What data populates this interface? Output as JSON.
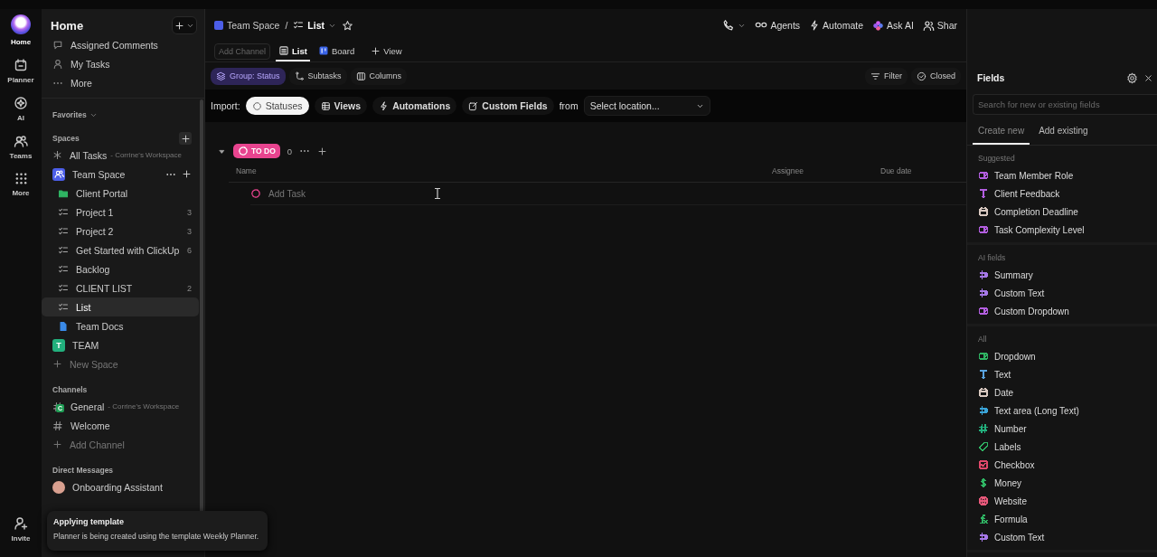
{
  "rail": {
    "items": [
      {
        "kind": "home",
        "label": "Home",
        "selected": true
      },
      {
        "kind": "planner",
        "label": "Planner",
        "selected": false
      },
      {
        "kind": "ai",
        "label": "AI",
        "selected": false
      },
      {
        "kind": "teams",
        "label": "Teams",
        "selected": false
      },
      {
        "kind": "more",
        "label": "More",
        "selected": false
      }
    ],
    "invite": {
      "label": "Invite"
    }
  },
  "sidebar": {
    "title": "Home",
    "nav": [
      {
        "kind": "comments",
        "label": "Assigned Comments"
      },
      {
        "kind": "tasks",
        "label": "My Tasks"
      },
      {
        "kind": "more",
        "label": "More"
      }
    ],
    "favorites": "Favorites",
    "spaces": {
      "label": "Spaces",
      "items": [
        {
          "kind": "all",
          "label": "All Tasks",
          "note": "- Corrine's Workspace"
        },
        {
          "kind": "space",
          "label": "Team Space",
          "color": "#4c5ee8",
          "children": [
            {
              "kind": "folder",
              "label": "Client Portal",
              "selected": false
            },
            {
              "kind": "list",
              "label": "Project 1",
              "count": "3",
              "selected": false
            },
            {
              "kind": "list",
              "label": "Project 2",
              "count": "3",
              "selected": false
            },
            {
              "kind": "list",
              "label": "Get Started with ClickUp",
              "count": "6",
              "selected": false
            },
            {
              "kind": "list",
              "label": "Backlog",
              "selected": false
            },
            {
              "kind": "list",
              "label": "CLIENT LIST",
              "count": "2",
              "selected": false
            },
            {
              "kind": "list",
              "label": "List",
              "selected": true
            },
            {
              "kind": "doc",
              "label": "Team Docs",
              "selected": false
            }
          ]
        },
        {
          "kind": "space",
          "label": "TEAM",
          "letter": "T",
          "color": "#22b07d"
        },
        {
          "kind": "add",
          "label": "New Space"
        }
      ]
    },
    "channels": {
      "label": "Channels",
      "items": [
        {
          "kind": "channel",
          "label": "General",
          "note": "- Corrine's Workspace",
          "badge": "C"
        },
        {
          "kind": "channel",
          "label": "Welcome"
        },
        {
          "kind": "add",
          "label": "Add Channel"
        }
      ]
    },
    "direct_messages": {
      "label": "Direct Messages",
      "items": [
        {
          "label": "Onboarding Assistant"
        }
      ]
    }
  },
  "toast": {
    "title": "Applying template",
    "message": "Planner is being created using the template Weekly Planner."
  },
  "header": {
    "breadcrumb": [
      "Team Space",
      "/",
      "List"
    ],
    "actions": [
      {
        "kind": "agents",
        "label": "Agents"
      },
      {
        "kind": "automate",
        "label": "Automate"
      },
      {
        "kind": "ai",
        "label": "Ask AI"
      },
      {
        "kind": "share",
        "label": "Shar"
      }
    ]
  },
  "views": {
    "add_channel": "Add Channel",
    "tabs": [
      {
        "kind": "list",
        "label": "List",
        "selected": true
      },
      {
        "kind": "board",
        "label": "Board",
        "selected": false
      }
    ],
    "add_view": "View"
  },
  "toolbar": {
    "left": [
      {
        "kind": "group",
        "label": "Group: Status",
        "selected": true
      },
      {
        "kind": "subtasks",
        "label": "Subtasks",
        "selected": false
      },
      {
        "kind": "columns",
        "label": "Columns",
        "selected": false
      }
    ],
    "right": [
      {
        "kind": "filter",
        "label": "Filter"
      },
      {
        "kind": "closed",
        "label": "Closed"
      }
    ]
  },
  "import_bar": {
    "label": "Import:",
    "options": [
      {
        "kind": "statuses",
        "label": "Statuses",
        "selected": true
      },
      {
        "kind": "views",
        "label": "Views",
        "selected": false
      },
      {
        "kind": "automations",
        "label": "Automations",
        "selected": false
      },
      {
        "kind": "fields",
        "label": "Custom Fields",
        "selected": false
      }
    ],
    "from": "from",
    "location": {
      "placeholder": "Select location..."
    }
  },
  "group": {
    "status": "TO DO",
    "color": "#e8448f",
    "count": "0",
    "columns": [
      "Name",
      "Assignee",
      "Due date"
    ],
    "add_task": "Add Task"
  },
  "fields_panel": {
    "title": "Fields",
    "search": {
      "placeholder": "Search for new or existing fields"
    },
    "tabs": [
      {
        "label": "Create new",
        "selected": true
      },
      {
        "label": "Add existing",
        "selected": false
      }
    ],
    "sections": [
      {
        "title": "Suggested",
        "items": [
          {
            "kind": "dropdown",
            "label": "Team Member Role",
            "color": "#b35ee0"
          },
          {
            "kind": "text",
            "label": "Client Feedback",
            "color": "#b35ee0"
          },
          {
            "kind": "date",
            "label": "Completion Deadline",
            "color": "#d8c8c0"
          },
          {
            "kind": "dropdown",
            "label": "Task Complexity Level",
            "color": "#b35ee0"
          }
        ]
      },
      {
        "title": "AI fields",
        "items": [
          {
            "kind": "textarea",
            "label": "Summary",
            "color": "#a678e8"
          },
          {
            "kind": "textarea",
            "label": "Custom Text",
            "color": "#a678e8"
          },
          {
            "kind": "dropdown",
            "label": "Custom Dropdown",
            "color": "#b35ee0"
          }
        ]
      },
      {
        "title": "All",
        "items": [
          {
            "kind": "dropdown",
            "label": "Dropdown",
            "color": "#2fb463"
          },
          {
            "kind": "text",
            "label": "Text",
            "color": "#5aa4e0"
          },
          {
            "kind": "date",
            "label": "Date",
            "color": "#d8c8c0"
          },
          {
            "kind": "textarea",
            "label": "Text area (Long Text)",
            "color": "#3aa4d8"
          },
          {
            "kind": "number",
            "label": "Number",
            "color": "#22b07d"
          },
          {
            "kind": "labels",
            "label": "Labels",
            "color": "#2fb463"
          },
          {
            "kind": "checkbox",
            "label": "Checkbox",
            "color": "#e0486a"
          },
          {
            "kind": "money",
            "label": "Money",
            "color": "#2fb463"
          },
          {
            "kind": "website",
            "label": "Website",
            "color": "#e8587a"
          },
          {
            "kind": "formula",
            "label": "Formula",
            "color": "#2fb463"
          },
          {
            "kind": "textarea",
            "label": "Custom Text",
            "color": "#a678e8"
          }
        ]
      }
    ]
  }
}
